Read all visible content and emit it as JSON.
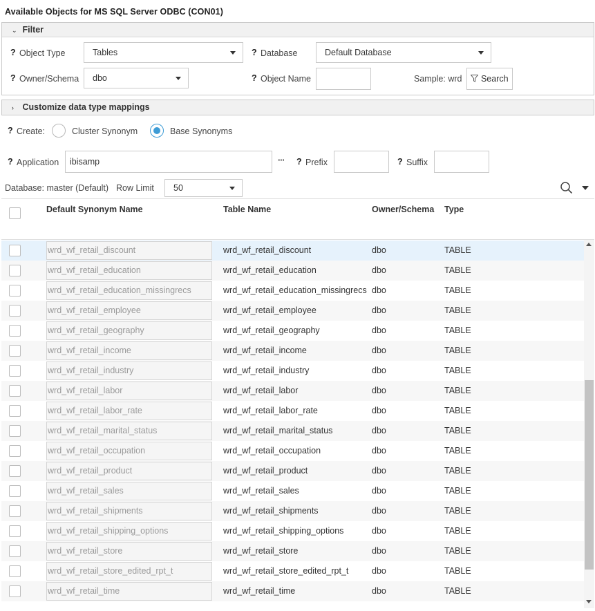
{
  "window_title": "Available Objects for MS SQL Server ODBC (CON01)",
  "filter": {
    "header": "Filter",
    "object_type_label": "Object Type",
    "object_type_value": "Tables",
    "database_label": "Database",
    "database_value": "Default Database",
    "owner_label": "Owner/Schema",
    "owner_value": "dbo",
    "object_name_label": "Object Name",
    "object_name_value": "",
    "sample_label": "Sample: wrd",
    "search_label": "Search"
  },
  "mappings": {
    "header": "Customize data type mappings"
  },
  "create": {
    "label": "Create:",
    "option1": "Cluster Synonym",
    "option2": "Base Synonyms",
    "selected": "Base Synonyms"
  },
  "application": {
    "label": "Application",
    "value": "ibisamp",
    "ellipsis": "···",
    "prefix_label": "Prefix",
    "prefix_value": "",
    "suffix_label": "Suffix",
    "suffix_value": ""
  },
  "status": {
    "database_text": "Database: master (Default)",
    "row_limit_label": "Row Limit",
    "row_limit_value": "50"
  },
  "question_mark": "?",
  "table": {
    "columns": [
      "Default Synonym Name",
      "Table Name",
      "Owner/Schema",
      "Type"
    ],
    "rows": [
      {
        "synonym": "wrd_wf_retail_discount",
        "table": "wrd_wf_retail_discount",
        "owner": "dbo",
        "type": "TABLE"
      },
      {
        "synonym": "wrd_wf_retail_education",
        "table": "wrd_wf_retail_education",
        "owner": "dbo",
        "type": "TABLE"
      },
      {
        "synonym": "wrd_wf_retail_education_missingrecs",
        "table": "wrd_wf_retail_education_missingrecs",
        "owner": "dbo",
        "type": "TABLE"
      },
      {
        "synonym": "wrd_wf_retail_employee",
        "table": "wrd_wf_retail_employee",
        "owner": "dbo",
        "type": "TABLE"
      },
      {
        "synonym": "wrd_wf_retail_geography",
        "table": "wrd_wf_retail_geography",
        "owner": "dbo",
        "type": "TABLE"
      },
      {
        "synonym": "wrd_wf_retail_income",
        "table": "wrd_wf_retail_income",
        "owner": "dbo",
        "type": "TABLE"
      },
      {
        "synonym": "wrd_wf_retail_industry",
        "table": "wrd_wf_retail_industry",
        "owner": "dbo",
        "type": "TABLE"
      },
      {
        "synonym": "wrd_wf_retail_labor",
        "table": "wrd_wf_retail_labor",
        "owner": "dbo",
        "type": "TABLE"
      },
      {
        "synonym": "wrd_wf_retail_labor_rate",
        "table": "wrd_wf_retail_labor_rate",
        "owner": "dbo",
        "type": "TABLE"
      },
      {
        "synonym": "wrd_wf_retail_marital_status",
        "table": "wrd_wf_retail_marital_status",
        "owner": "dbo",
        "type": "TABLE"
      },
      {
        "synonym": "wrd_wf_retail_occupation",
        "table": "wrd_wf_retail_occupation",
        "owner": "dbo",
        "type": "TABLE"
      },
      {
        "synonym": "wrd_wf_retail_product",
        "table": "wrd_wf_retail_product",
        "owner": "dbo",
        "type": "TABLE"
      },
      {
        "synonym": "wrd_wf_retail_sales",
        "table": "wrd_wf_retail_sales",
        "owner": "dbo",
        "type": "TABLE"
      },
      {
        "synonym": "wrd_wf_retail_shipments",
        "table": "wrd_wf_retail_shipments",
        "owner": "dbo",
        "type": "TABLE"
      },
      {
        "synonym": "wrd_wf_retail_shipping_options",
        "table": "wrd_wf_retail_shipping_options",
        "owner": "dbo",
        "type": "TABLE"
      },
      {
        "synonym": "wrd_wf_retail_store",
        "table": "wrd_wf_retail_store",
        "owner": "dbo",
        "type": "TABLE"
      },
      {
        "synonym": "wrd_wf_retail_store_edited_rpt_t",
        "table": "wrd_wf_retail_store_edited_rpt_t",
        "owner": "dbo",
        "type": "TABLE"
      },
      {
        "synonym": "wrd_wf_retail_time",
        "table": "wrd_wf_retail_time",
        "owner": "dbo",
        "type": "TABLE"
      }
    ]
  },
  "colors": {
    "accent": "#3e9cd6",
    "selected_row": "#e6f2fc",
    "alt_row": "#f7f7f7"
  }
}
